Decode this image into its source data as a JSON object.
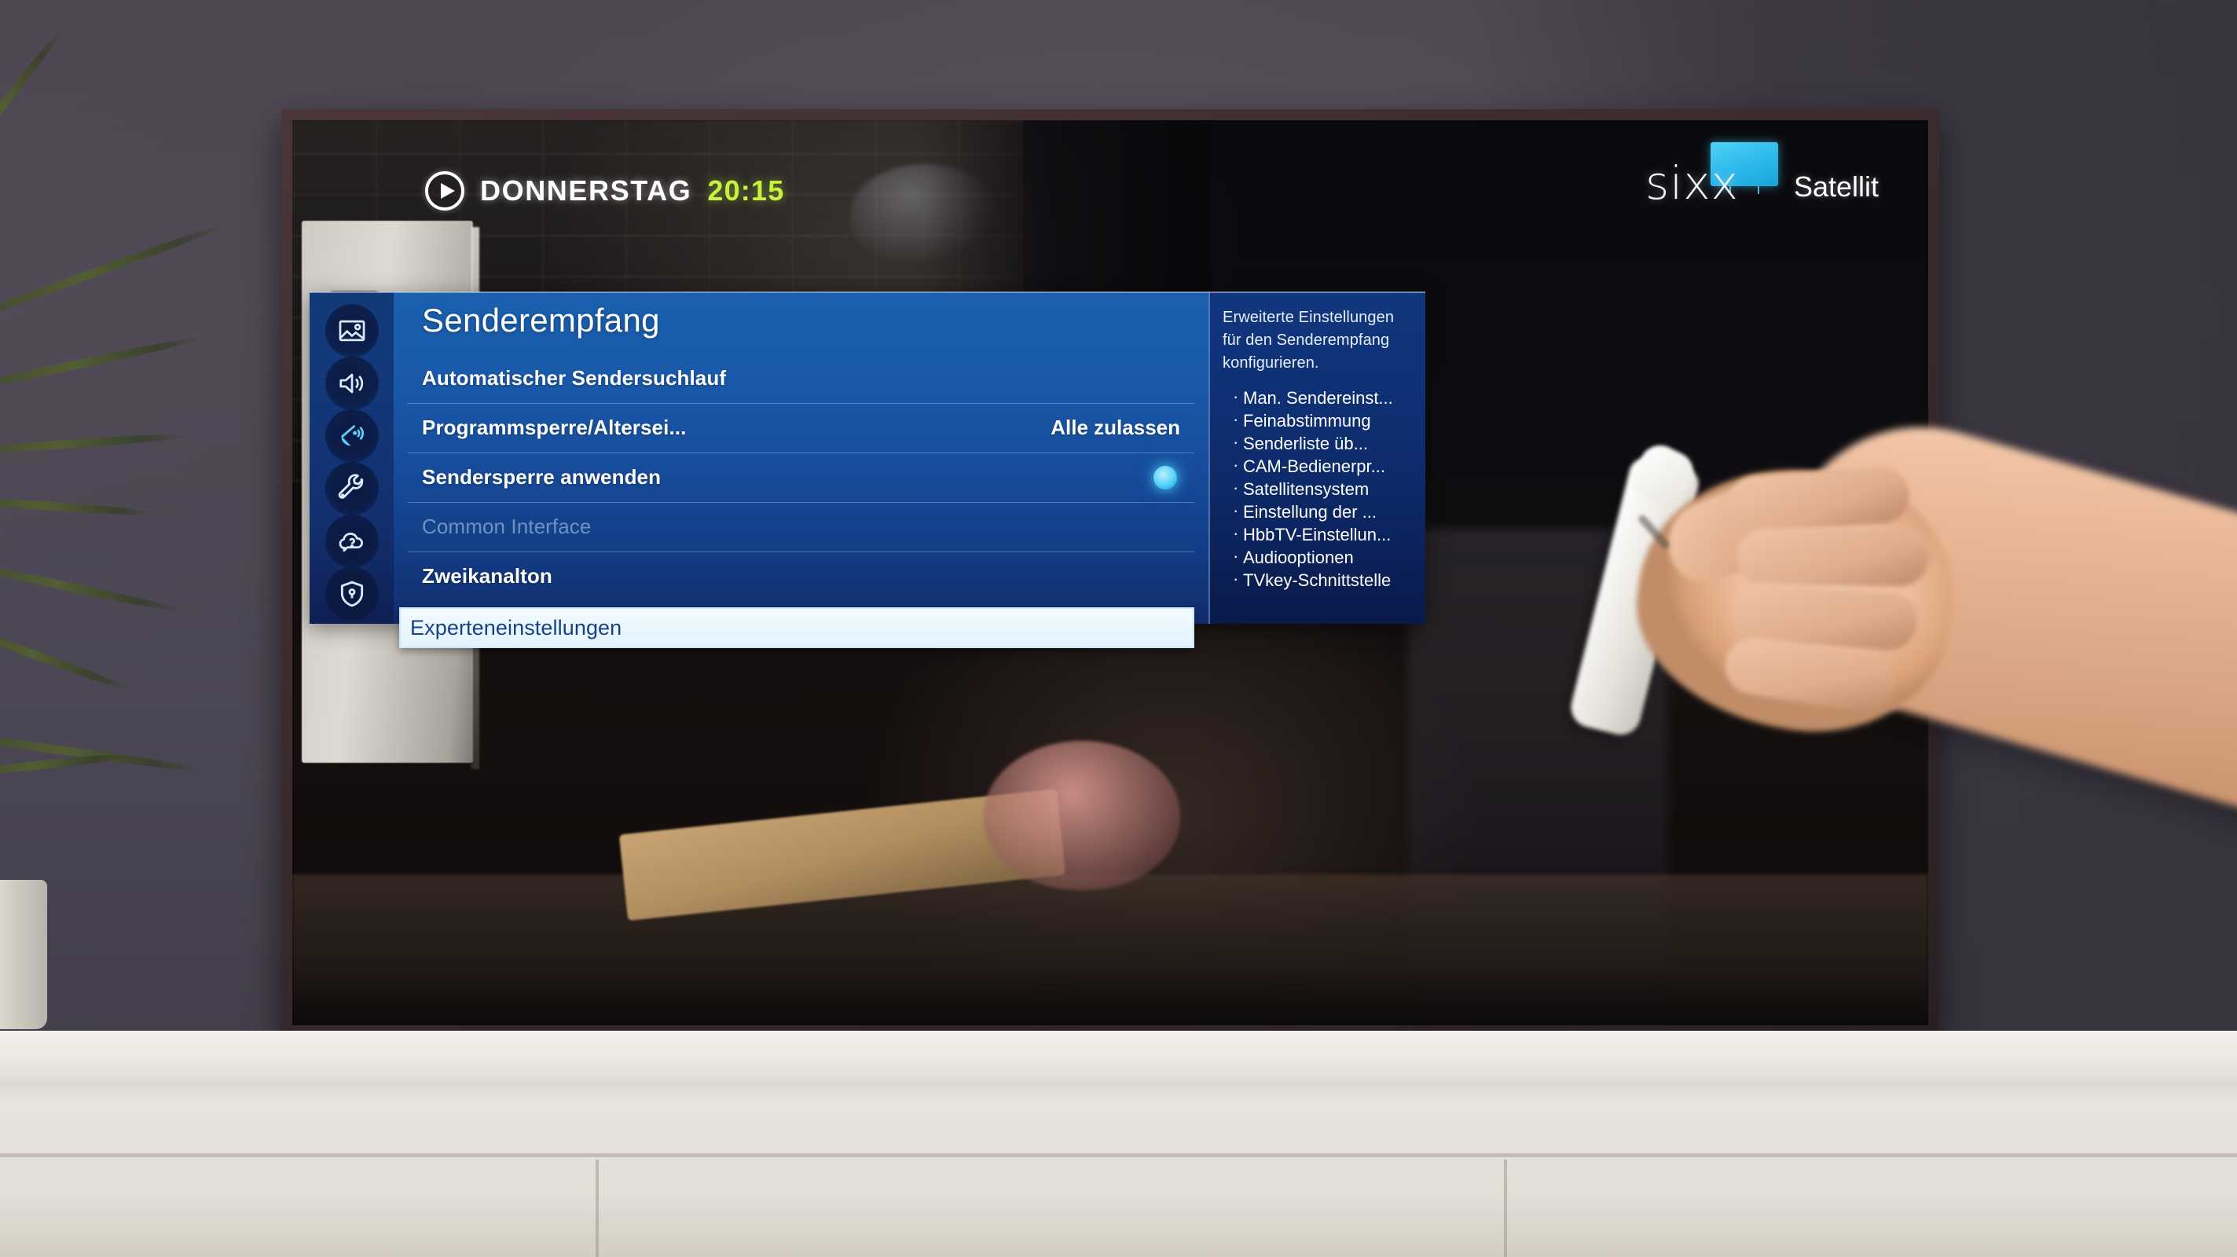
{
  "osd": {
    "now_playing": {
      "play_icon": "play-circle-icon",
      "day": "DONNERSTAG",
      "time": "20:15",
      "time_color": "#c8f03c"
    },
    "brand": {
      "channel_logo_text": "sixx",
      "tv_badge_icon": "tv-screen-icon",
      "tv_badge_color": "#3cc8f0",
      "source_label": "Satellit"
    }
  },
  "settings": {
    "title": "Senderempfang",
    "sidebar": {
      "items": [
        {
          "icon": "picture-icon",
          "name": "picture",
          "active": false
        },
        {
          "icon": "sound-icon",
          "name": "sound",
          "active": false
        },
        {
          "icon": "broadcasting-icon",
          "name": "broadcasting",
          "active": true
        },
        {
          "icon": "wrench-icon",
          "name": "general",
          "active": false
        },
        {
          "icon": "support-icon",
          "name": "support",
          "active": false
        },
        {
          "icon": "shield-lock-icon",
          "name": "privacy",
          "active": false
        }
      ]
    },
    "rows": [
      {
        "label": "Automatischer Sendersuchlauf",
        "value": "",
        "type": "nav",
        "disabled": false,
        "selected": false
      },
      {
        "label": "Programmsperre/Altersei...",
        "value": "Alle zulassen",
        "type": "value",
        "disabled": false,
        "selected": false
      },
      {
        "label": "Sendersperre anwenden",
        "value": "",
        "type": "toggle",
        "disabled": false,
        "selected": false
      },
      {
        "label": "Common Interface",
        "value": "",
        "type": "nav",
        "disabled": true,
        "selected": false
      },
      {
        "label": "Zweikanalton",
        "value": "",
        "type": "nav",
        "disabled": false,
        "selected": false
      },
      {
        "label": "Experteneinstellungen",
        "value": "",
        "type": "nav",
        "disabled": false,
        "selected": true
      }
    ],
    "info": {
      "description": "Erweiterte Einstellungen für den Senderempfang konfigurieren.",
      "items": [
        "Man. Sendereinst...",
        "Feinabstimmung",
        "Senderliste üb...",
        "CAM-Bedienerpr...",
        "Satellitensystem",
        "Einstellung der ...",
        "HbbTV-Einstellun...",
        "Audiooptionen",
        "TVkey-Schnittstelle"
      ]
    }
  },
  "colors": {
    "panel_blue": "#17539e",
    "panel_blue_dark": "#112c6d",
    "rail_blue": "#123a78",
    "info_blue": "#0d2a69",
    "accent_cyan": "#5cd2fa",
    "selected_bg": "#eaf7fd",
    "selected_text": "#17408c",
    "disabled_text": "#6f92c4",
    "tv_bezel": "#3e2d30",
    "wall": "#4c4752",
    "sideboard": "#e6e2da"
  },
  "scene": {
    "device": "television",
    "hand": "hand-holding-remote",
    "remote": "tv-remote-control",
    "plant": "potted-plant"
  }
}
